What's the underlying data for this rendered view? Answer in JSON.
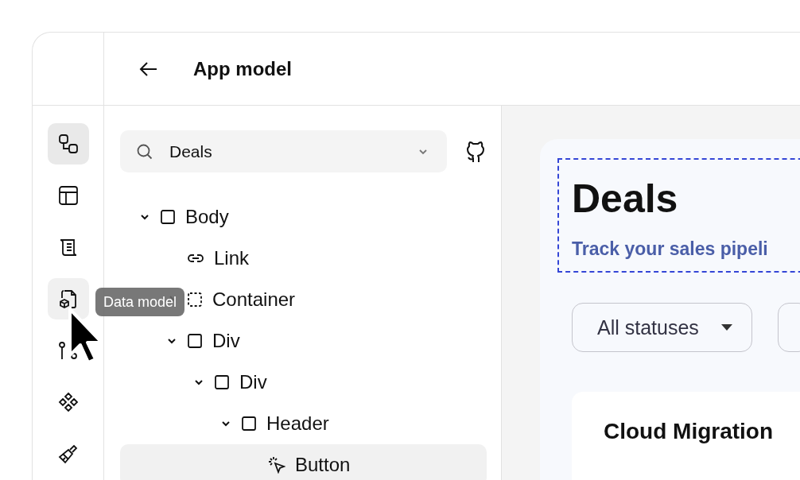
{
  "header": {
    "title": "App model"
  },
  "rail": [
    {
      "kind": "flow",
      "selected": true,
      "hovered": false
    },
    {
      "kind": "layout",
      "selected": false,
      "hovered": false
    },
    {
      "kind": "scroll",
      "selected": false,
      "hovered": false
    },
    {
      "kind": "data",
      "selected": false,
      "hovered": true
    },
    {
      "kind": "pins",
      "selected": false,
      "hovered": false
    },
    {
      "kind": "components",
      "selected": false,
      "hovered": false
    },
    {
      "kind": "brush",
      "selected": false,
      "hovered": false
    }
  ],
  "tooltip": {
    "text": "Data model"
  },
  "search": {
    "value": "Deals"
  },
  "tree": [
    {
      "label": "Body",
      "kind": "element",
      "expanded": true,
      "selected": false,
      "children": [
        {
          "label": "Link",
          "kind": "link",
          "selected": false
        },
        {
          "label": "Container",
          "kind": "container",
          "expanded": false,
          "selected": false
        },
        {
          "label": "Div",
          "kind": "element",
          "expanded": true,
          "selected": false,
          "children": [
            {
              "label": "Div",
              "kind": "element",
              "expanded": true,
              "selected": false,
              "children": [
                {
                  "label": "Header",
                  "kind": "element",
                  "expanded": true,
                  "selected": false,
                  "children": [
                    {
                      "label": "Button",
                      "kind": "button",
                      "selected": true
                    }
                  ]
                }
              ]
            }
          ]
        }
      ]
    }
  ],
  "preview": {
    "title": "Deals",
    "subtitle": "Track your sales pipeli",
    "filters": [
      {
        "kind": "dropdown",
        "label": "All statuses"
      },
      {
        "kind": "partial"
      }
    ],
    "card": {
      "title": "Cloud Migration"
    }
  }
}
